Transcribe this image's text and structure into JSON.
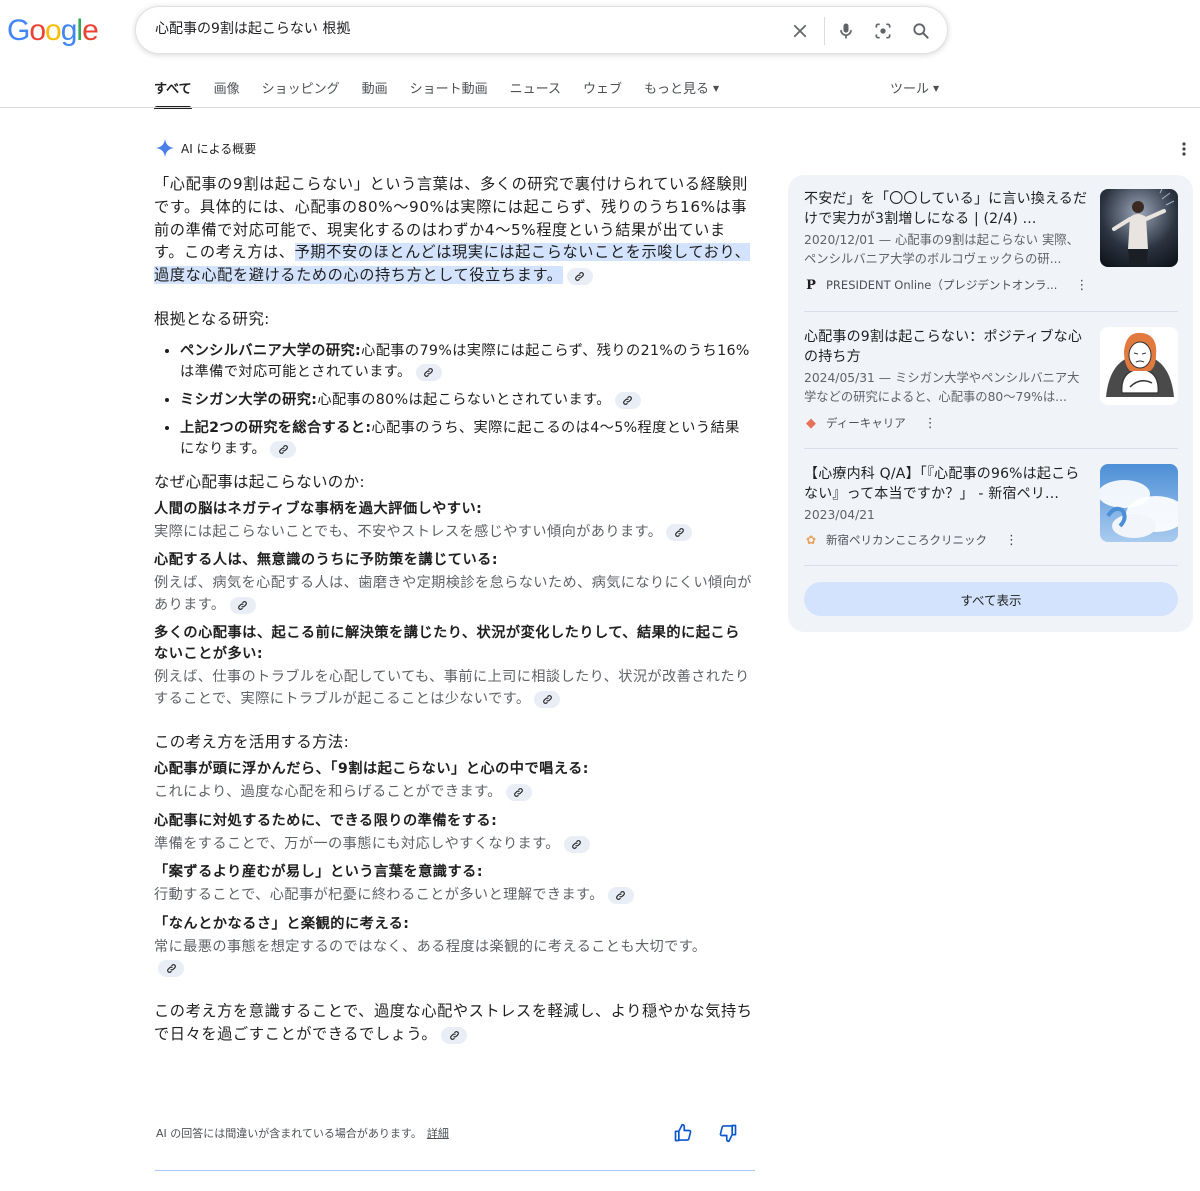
{
  "logo": {
    "letters": [
      "G",
      "o",
      "o",
      "g",
      "l",
      "e"
    ],
    "colors": [
      "#4285F4",
      "#EA4335",
      "#FBBC05",
      "#4285F4",
      "#34A853",
      "#EA4335"
    ]
  },
  "search": {
    "query": "心配事の9割は起こらない 根拠"
  },
  "tabs": [
    {
      "label": "すべて"
    },
    {
      "label": "画像"
    },
    {
      "label": "ショッピング"
    },
    {
      "label": "動画"
    },
    {
      "label": "ショート動画"
    },
    {
      "label": "ニュース"
    },
    {
      "label": "ウェブ"
    },
    {
      "label": "もっと見る"
    }
  ],
  "tools_label": "ツール",
  "ai": {
    "header": "AI による概要",
    "lead_part1": "「心配事の9割は起こらない」という言葉は、多くの研究で裏付けられている経験則です。具体的には、心配事の80%〜90%は実際には起こらず、残りのうち16%は事前の準備で対応可能で、現実化するのはわずか4〜5%程度という結果が出ています。この考え方は、",
    "lead_highlight": "予期不安のほとんどは現実には起こらないことを示唆しており、過度な心配を避けるための心の持ち方として役立ちます。",
    "section1_title": "根拠となる研究:",
    "studies": [
      {
        "bold": "ペンシルバニア大学の研究:",
        "text": "心配事の79%は実際には起こらず、残りの21%のうち16%は準備で対応可能とされています。"
      },
      {
        "bold": "ミシガン大学の研究:",
        "text": "心配事の80%は起こらないとされています。"
      },
      {
        "bold": "上記2つの研究を総合すると:",
        "text": "心配事のうち、実際に起こるのは4〜5%程度という結果になります。"
      }
    ],
    "section2_title": "なぜ心配事は起こらないのか:",
    "reasons": [
      {
        "title": "人間の脳はネガティブな事柄を過大評価しやすい:",
        "text": "実際には起こらないことでも、不安やストレスを感じやすい傾向があります。"
      },
      {
        "title": "心配する人は、無意識のうちに予防策を講じている:",
        "text": "例えば、病気を心配する人は、歯磨きや定期検診を怠らないため、病気になりにくい傾向があります。"
      },
      {
        "title": "多くの心配事は、起こる前に解決策を講じたり、状況が変化したりして、結果的に起こらないことが多い:",
        "text": "例えば、仕事のトラブルを心配していても、事前に上司に相談したり、状況が改善されたりすることで、実際にトラブルが起こることは少ないです。"
      }
    ],
    "section3_title": "この考え方を活用する方法:",
    "methods": [
      {
        "title": "心配事が頭に浮かんだら、「9割は起こらない」と心の中で唱える:",
        "text": "これにより、過度な心配を和らげることができます。"
      },
      {
        "title": "心配事に対処するために、できる限りの準備をする:",
        "text": "準備をすることで、万が一の事態にも対応しやすくなります。"
      },
      {
        "title": "「案ずるより産むが易し」という言葉を意識する:",
        "text": "行動することで、心配事が杞憂に終わることが多いと理解できます。"
      },
      {
        "title": "「なんとかなるさ」と楽観的に考える:",
        "text": "常に最悪の事態を想定するのではなく、ある程度は楽観的に考えることも大切です。"
      }
    ],
    "closing": "この考え方を意識することで、過度な心配やストレスを軽減し、より穏やかな気持ちで日々を過ごすことができるでしょう。",
    "disclaimer": "AI の回答には間違いが含まれている場合があります。",
    "details_link": "詳細"
  },
  "sources": [
    {
      "title": "不安だ」を「〇〇している」に言い換えるだけで実力が3割増しになる | (2/4) ...",
      "snippet": "2020/12/01 — 心配事の9割は起こらない 実際、ペンシルバニア大学のボルコヴェックらの研...",
      "site": "PRESIDENT Online（プレジデントオンラ...",
      "favicon_letter": "P",
      "favicon_color": "#1f1f1f"
    },
    {
      "title": "心配事の9割は起こらない：ポジティブな心の持ち方",
      "snippet": "2024/05/31 — ミシガン大学やペンシルバニア大学などの研究によると、心配事の80〜79%は...",
      "site": "ディーキャリア",
      "favicon_letter": "◆",
      "favicon_color": "#e8715a"
    },
    {
      "title": "【心療内科 Q/A】「『心配事の96%は起こらない』って本当ですか？」 - 新宿ペリ...",
      "snippet": "2023/04/21",
      "site": "新宿ペリカンこころクリニック",
      "favicon_letter": "✿",
      "favicon_color": "#e8a15a"
    }
  ],
  "show_all_label": "すべて表示"
}
